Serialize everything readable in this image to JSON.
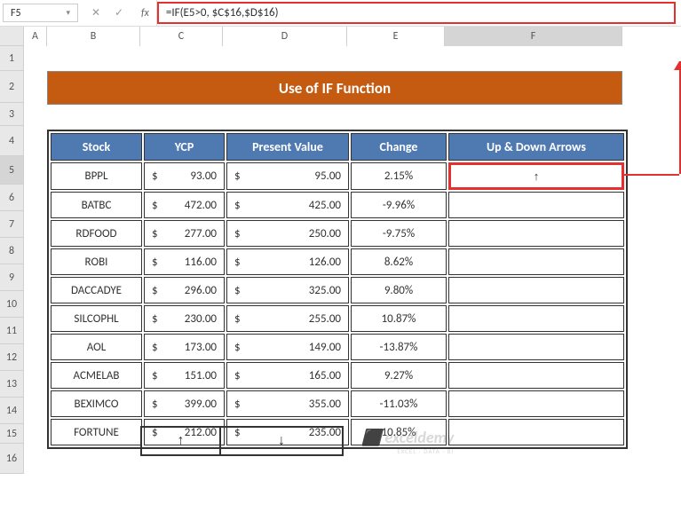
{
  "nameBox": "F5",
  "formula": "=IF(E5>0, $C$16,$D$16)",
  "fxLabel": "fx",
  "buttons": {
    "cancel": "✕",
    "confirm": "✓",
    "dropdown": "▾"
  },
  "columns": [
    "A",
    "B",
    "C",
    "D",
    "E",
    "F"
  ],
  "rows": [
    "1",
    "2",
    "3",
    "4",
    "5",
    "6",
    "7",
    "8",
    "9",
    "10",
    "11",
    "12",
    "13",
    "14",
    "15",
    "16"
  ],
  "title": "Use of IF Function",
  "headers": {
    "stock": "Stock",
    "ycp": "YCP",
    "pv": "Present Value",
    "change": "Change",
    "arrows": "Up & Down Arrows"
  },
  "rowsData": [
    {
      "stock": "BPPL",
      "ycp": "93.00",
      "pv": "95.00",
      "change": "2.15%",
      "arrow": "↑"
    },
    {
      "stock": "BATBC",
      "ycp": "472.00",
      "pv": "425.00",
      "change": "-9.96%",
      "arrow": ""
    },
    {
      "stock": "RDFOOD",
      "ycp": "277.00",
      "pv": "250.00",
      "change": "-9.75%",
      "arrow": ""
    },
    {
      "stock": "ROBI",
      "ycp": "116.00",
      "pv": "126.00",
      "change": "8.62%",
      "arrow": ""
    },
    {
      "stock": "DACCADYE",
      "ycp": "296.00",
      "pv": "325.00",
      "change": "9.80%",
      "arrow": ""
    },
    {
      "stock": "SILCOPHL",
      "ycp": "230.00",
      "pv": "255.00",
      "change": "10.87%",
      "arrow": ""
    },
    {
      "stock": "AOL",
      "ycp": "173.00",
      "pv": "149.00",
      "change": "-13.87%",
      "arrow": ""
    },
    {
      "stock": "ACMELAB",
      "ycp": "151.00",
      "pv": "165.00",
      "change": "9.27%",
      "arrow": ""
    },
    {
      "stock": "BEXIMCO",
      "ycp": "399.00",
      "pv": "355.00",
      "change": "-11.03%",
      "arrow": ""
    },
    {
      "stock": "FORTUNE",
      "ycp": "212.00",
      "pv": "235.00",
      "change": "10.85%",
      "arrow": ""
    }
  ],
  "currency": "$",
  "arrowSymbols": {
    "up": "↑",
    "down": "↓"
  },
  "watermark": {
    "top": "exceldemy",
    "sub": "EXCEL · DATA · BI"
  }
}
